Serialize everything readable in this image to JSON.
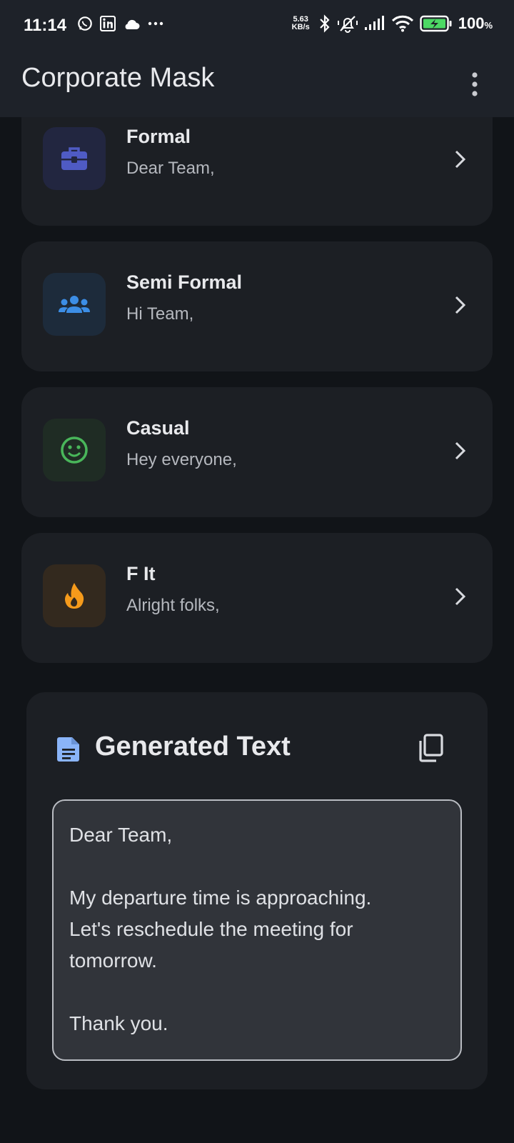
{
  "status_bar": {
    "time": "11:14",
    "speed_value": "5.63",
    "speed_unit": "KB/s",
    "battery_percent": "100",
    "battery_suffix": "%",
    "left_icons": [
      "whatsapp-icon",
      "linkedin-icon",
      "cloud-icon",
      "more-notifications-icon"
    ],
    "right_icons": [
      "bluetooth-icon",
      "silent-mode-icon",
      "signal-icon",
      "wifi-icon",
      "battery-charging-icon"
    ]
  },
  "app_bar": {
    "title": "Corporate Mask",
    "menu_icon": "more-vert-icon"
  },
  "tones": [
    {
      "title": "Formal",
      "greeting": "Dear Team,",
      "icon": "briefcase-icon",
      "icon_color": "#4f5bc4",
      "box_color": "#222640"
    },
    {
      "title": "Semi Formal",
      "greeting": "Hi Team,",
      "icon": "group-icon",
      "icon_color": "#3c8ee6",
      "box_color": "#1d2b3b"
    },
    {
      "title": "Casual",
      "greeting": "Hey everyone,",
      "icon": "smiley-icon",
      "icon_color": "#49b65a",
      "box_color": "#1f2c24"
    },
    {
      "title": "F It",
      "greeting": "Alright folks,",
      "icon": "fire-icon",
      "icon_color": "#f59a1b",
      "box_color": "#33291e"
    }
  ],
  "generated": {
    "title": "Generated Text",
    "icon": "document-icon",
    "icon_color": "#8ab4f8",
    "copy_icon": "copy-icon",
    "text": "Dear Team,\n\nMy departure time is approaching.\nLet's reschedule the meeting for\ntomorrow.\n\nThank you."
  }
}
